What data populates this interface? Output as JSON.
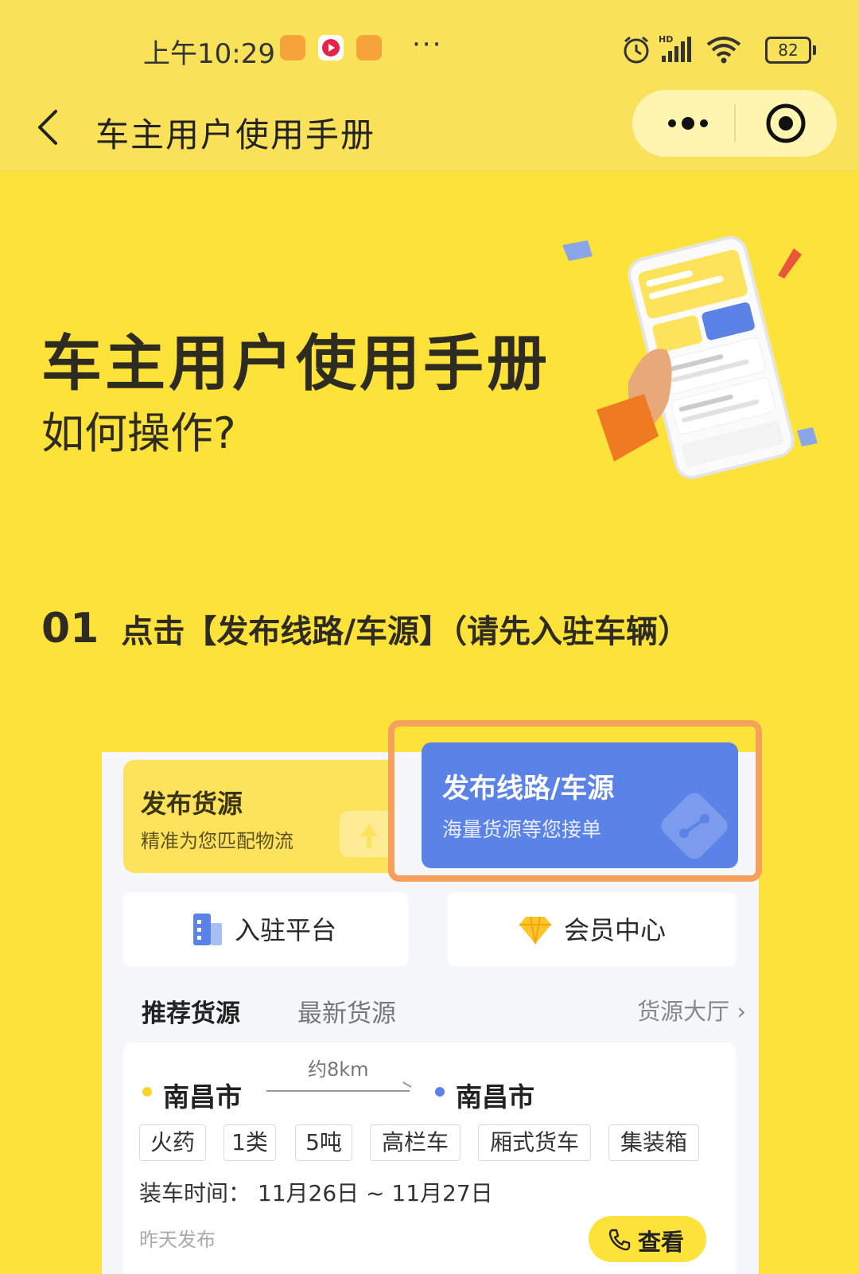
{
  "status_bar": {
    "time": "上午10:29",
    "more": "···",
    "battery": "82"
  },
  "nav": {
    "title": "车主用户使用手册"
  },
  "hero": {
    "title": "车主用户使用手册",
    "subtitle": "如何操作?"
  },
  "step": {
    "number": "01",
    "text": "点击【发布线路/车源】（请先入驻车辆）"
  },
  "app_screen": {
    "publish_goods": {
      "title": "发布货源",
      "subtitle": "精准为您匹配物流"
    },
    "publish_route": {
      "title": "发布线路/车源",
      "subtitle": "海量货源等您接单"
    },
    "quick": [
      {
        "label": "入驻平台",
        "icon": "building-icon"
      },
      {
        "label": "会员中心",
        "icon": "diamond-icon"
      }
    ],
    "tabs": {
      "recommended": "推荐货源",
      "latest": "最新货源",
      "hall": "货源大厅 ›"
    },
    "listing": {
      "from": "南昌市",
      "to": "南昌市",
      "distance": "约8km",
      "tags": [
        "火药",
        "1类",
        "5吨",
        "高栏车",
        "厢式货车",
        "集装箱"
      ],
      "load_time": "装车时间：  11月26日 ~ 11月27日",
      "posted": "昨天发布",
      "view_label": "查看"
    }
  },
  "colors": {
    "background": "#fde23a",
    "accent_blue": "#5b82e6",
    "highlight": "#f5a15c"
  }
}
